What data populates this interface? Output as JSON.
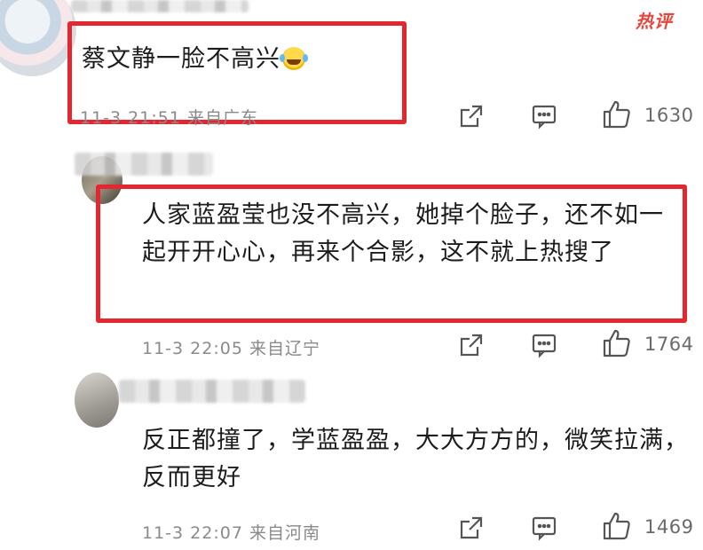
{
  "badge": {
    "hot_label": "热评"
  },
  "comments": [
    {
      "text": "蔡文静一脸不高兴",
      "time": "11-3 21:51",
      "location": "来自广东",
      "likes": "1630"
    },
    {
      "text": "人家蓝盈莹也没不高兴，她掉个脸子，还不如一起开开心心，再来个合影，这不就上热搜了",
      "time": "11-3 22:05",
      "location": "来自辽宁",
      "likes": "1764"
    },
    {
      "text": "反正都撞了，学蓝盈盈，大大方方的，微笑拉满，反而更好",
      "time": "11-3 22:07",
      "location": "来自河南",
      "likes": "1469"
    }
  ],
  "icons": {
    "share": "share-icon",
    "reply": "comment-icon",
    "like": "thumbs-up-icon",
    "emoji": "laughing-crying-emoji"
  },
  "colors": {
    "highlight_box": "#e3262f",
    "hot_badge": "#e8453c",
    "meta_text": "#8a8a8a"
  }
}
